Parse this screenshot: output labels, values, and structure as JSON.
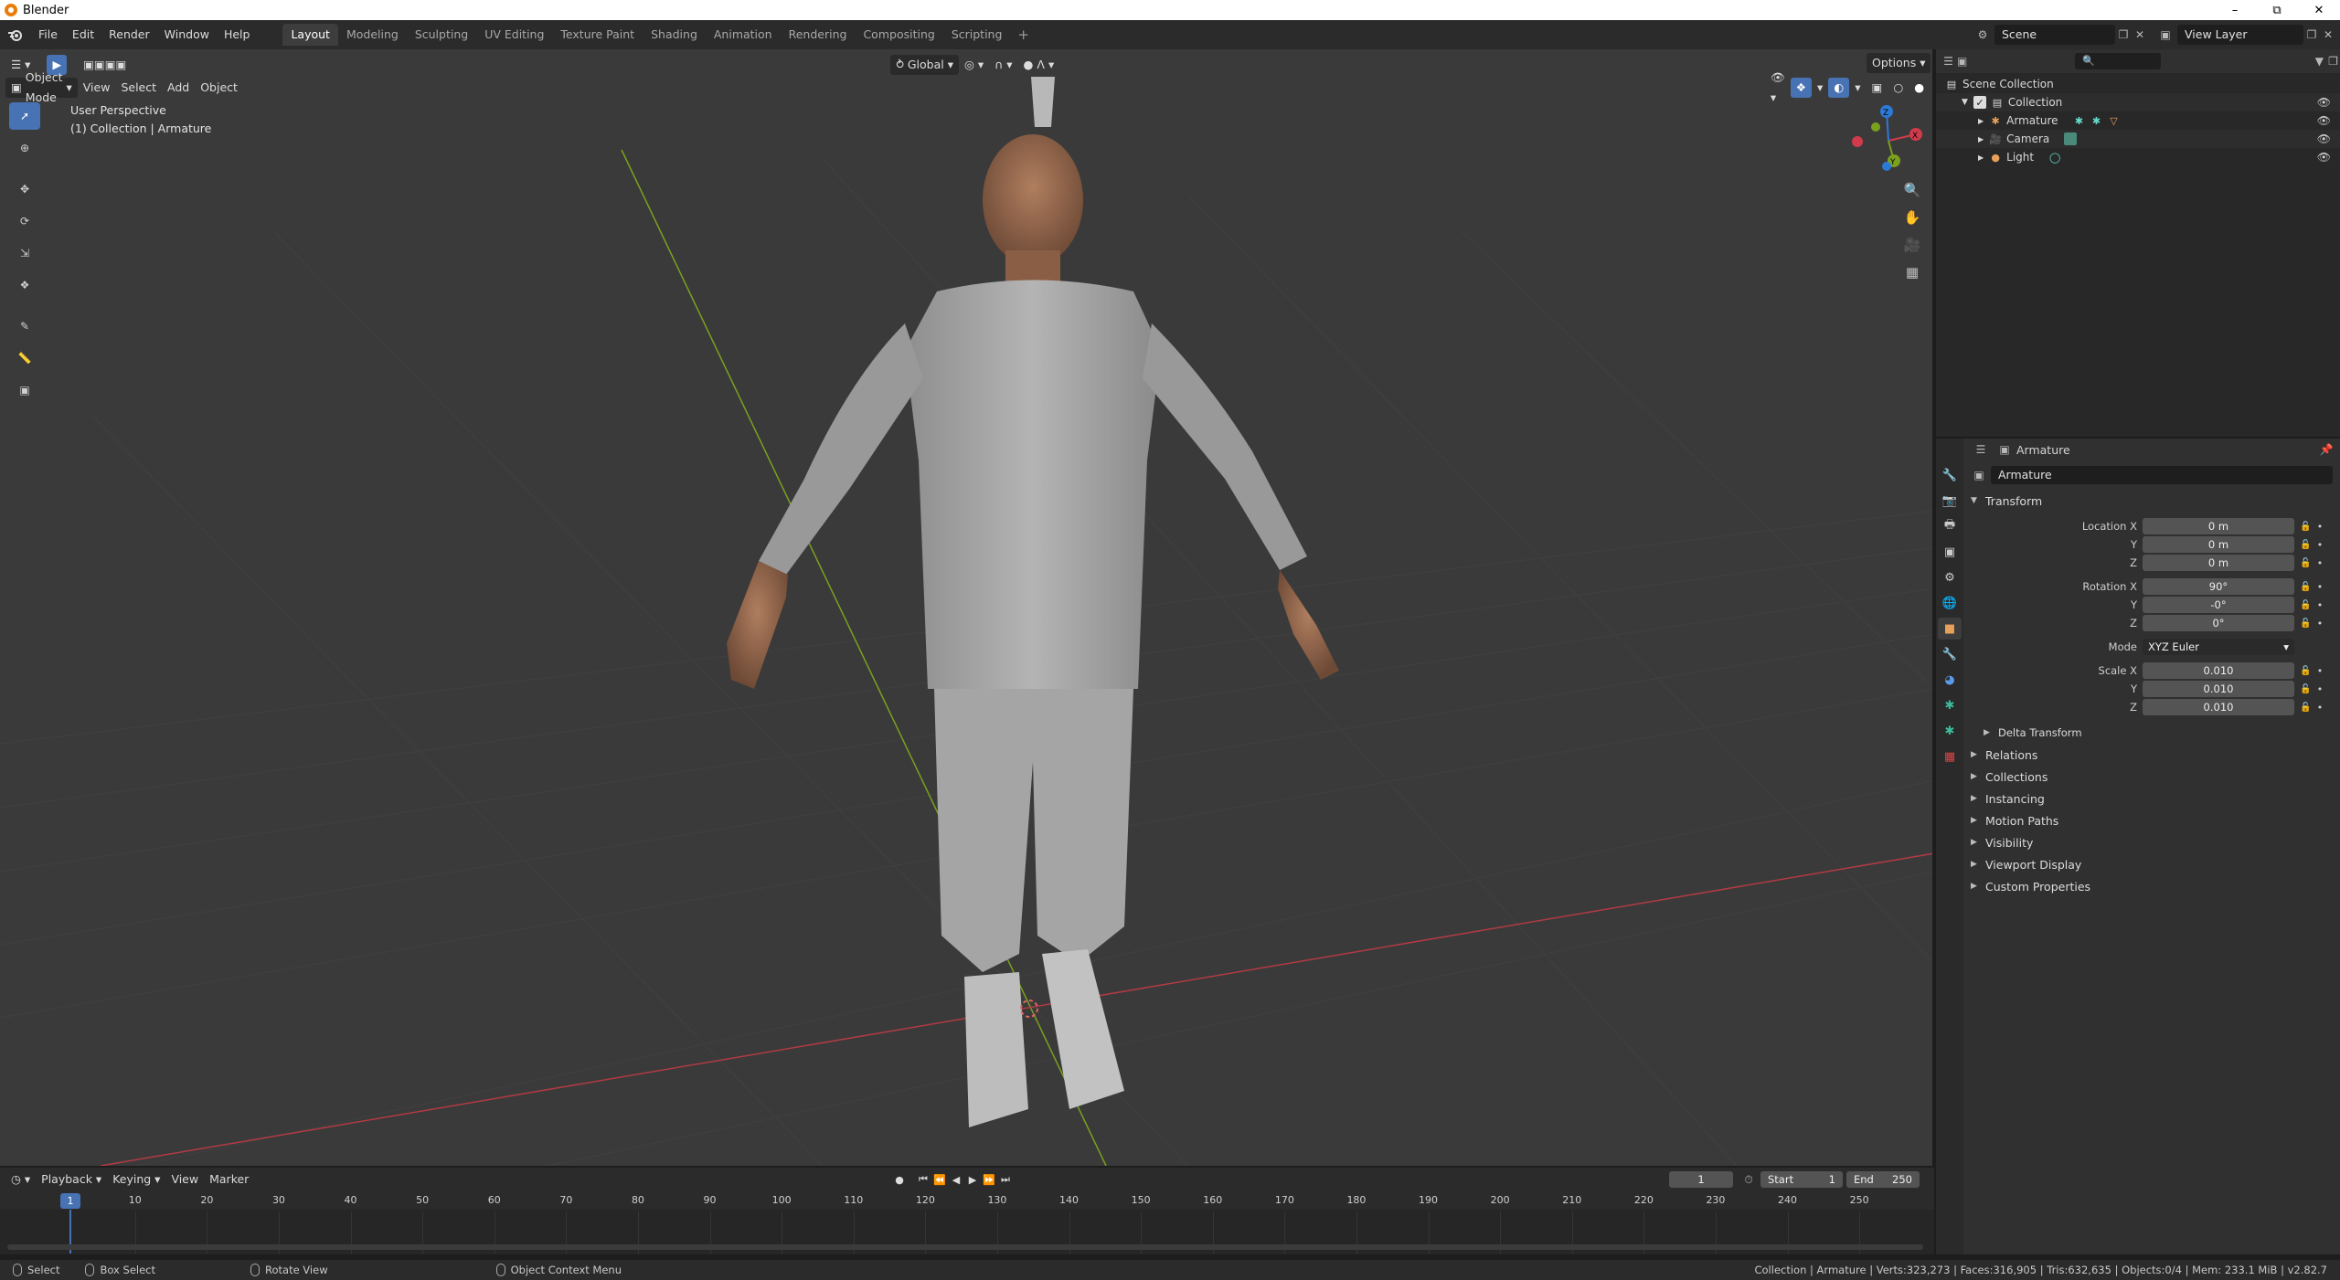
{
  "window": {
    "title": "Blender",
    "minimize": "–",
    "maximize": "⧉",
    "close": "✕"
  },
  "menu": [
    "File",
    "Edit",
    "Render",
    "Window",
    "Help"
  ],
  "workspaces": [
    "Layout",
    "Modeling",
    "Sculpting",
    "UV Editing",
    "Texture Paint",
    "Shading",
    "Animation",
    "Rendering",
    "Compositing",
    "Scripting"
  ],
  "workspace_add": "+",
  "scene": "Scene",
  "view_layer": "View Layer",
  "viewport": {
    "mode": "Object Mode",
    "menus": [
      "View",
      "Select",
      "Add",
      "Object"
    ],
    "orientation": "Global",
    "options": "Options",
    "overlay_line1": "User Perspective",
    "overlay_line2": "(1) Collection | Armature",
    "axis_labels": {
      "x": "X",
      "y": "Y",
      "z": "Z"
    }
  },
  "outliner": {
    "scene_collection": "Scene Collection",
    "collection": "Collection",
    "objects": [
      "Armature",
      "Camera",
      "Light"
    ]
  },
  "properties": {
    "object_name_header": "Armature",
    "object_name": "Armature",
    "transform_label": "Transform",
    "location_x_label": "Location X",
    "y_label": "Y",
    "z_label": "Z",
    "location": [
      "0 m",
      "0 m",
      "0 m"
    ],
    "rotation_x_label": "Rotation X",
    "rotation": [
      "90°",
      "-0°",
      "0°"
    ],
    "mode_label": "Mode",
    "mode_value": "XYZ Euler",
    "scale_x_label": "Scale X",
    "scale": [
      "0.010",
      "0.010",
      "0.010"
    ],
    "delta_transform": "Delta Transform",
    "panels": [
      "Relations",
      "Collections",
      "Instancing",
      "Motion Paths",
      "Visibility",
      "Viewport Display",
      "Custom Properties"
    ]
  },
  "timeline": {
    "menus": [
      "Playback",
      "Keying",
      "View",
      "Marker"
    ],
    "current_frame": "1",
    "start_label": "Start",
    "start": "1",
    "end_label": "End",
    "end": "250",
    "ticks": [
      "10",
      "20",
      "30",
      "40",
      "50",
      "60",
      "70",
      "80",
      "90",
      "100",
      "110",
      "120",
      "130",
      "140",
      "150",
      "160",
      "170",
      "180",
      "190",
      "200",
      "210",
      "220",
      "230",
      "240",
      "250"
    ],
    "cursor_frame": "1"
  },
  "status": {
    "select": "Select",
    "box_select": "Box Select",
    "rotate_view": "Rotate View",
    "context_menu": "Object Context Menu",
    "info": "Collection | Armature | Verts:323,273 | Faces:316,905 | Tris:632,635 | Objects:0/4 | Mem: 233.1 MiB | v2.82.7"
  },
  "colors": {
    "accent": "#4772b3",
    "x_axis": "#d03b4b",
    "y_axis": "#7aa11e",
    "z_axis": "#2d79d6",
    "viewport_bg": "#3a3a3a"
  }
}
